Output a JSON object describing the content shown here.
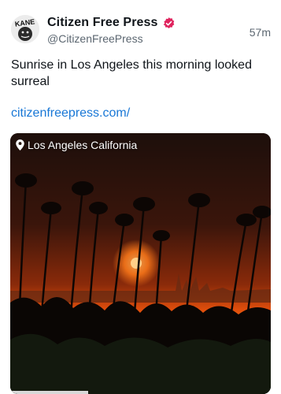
{
  "post": {
    "display_name": "Citizen Free Press",
    "handle": "@CitizenFreePress",
    "timestamp": "57m",
    "text": "Sunrise in Los Angeles this morning looked surreal",
    "link_text": "citizenfreepress.com/",
    "verified_icon": "verified-badge-icon",
    "verified_color": "#e0245e",
    "link_color": "#1877d6"
  },
  "avatar": {
    "logo_text": "KANE"
  },
  "media": {
    "location_icon": "map-pin-icon",
    "location_label": "Los Angeles California",
    "progress": 0.3
  }
}
